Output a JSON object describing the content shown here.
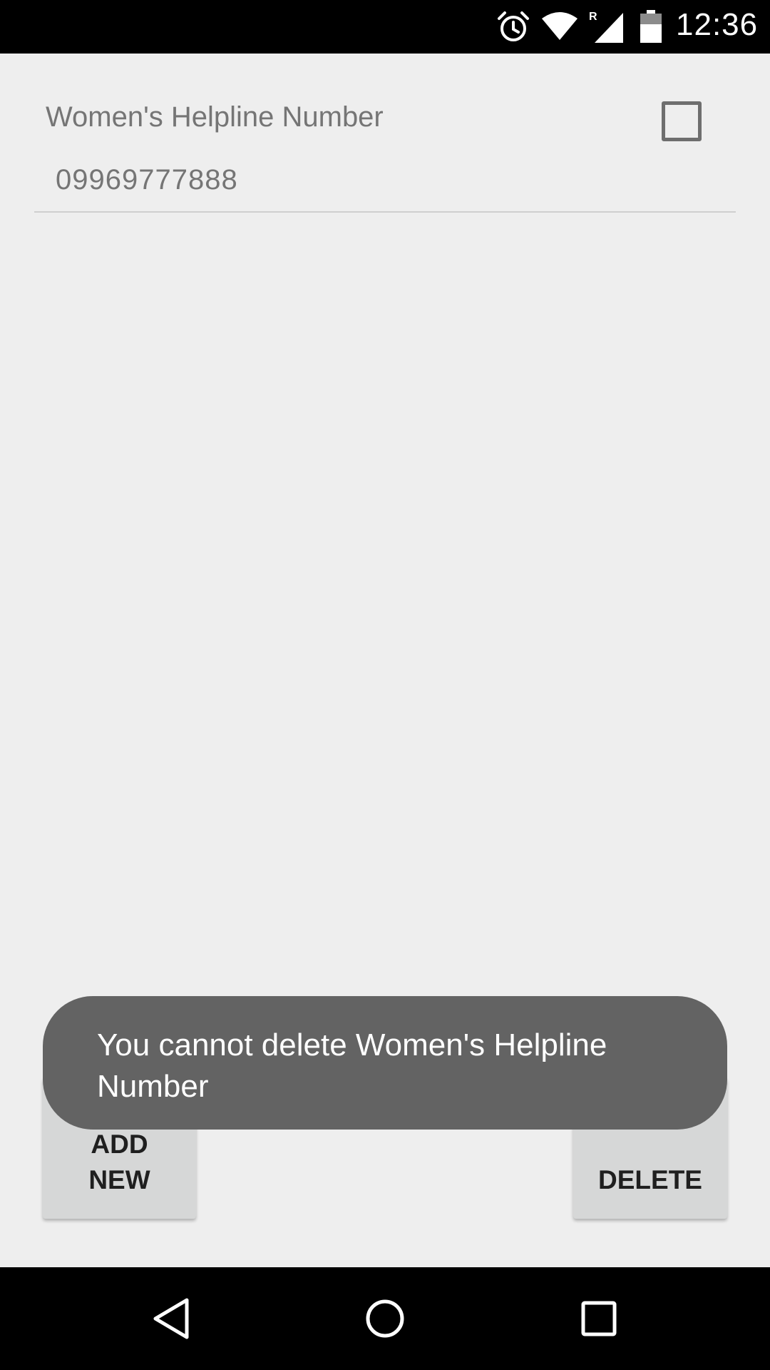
{
  "status_bar": {
    "time": "12:36",
    "icons": [
      "alarm-icon",
      "wifi-icon",
      "signal-icon",
      "battery-icon"
    ],
    "signal_roaming_label": "R"
  },
  "list": {
    "items": [
      {
        "title": "Women's Helpline Number",
        "number": "09969777888",
        "checked": false
      }
    ]
  },
  "buttons": {
    "add_new_label": "ADD NEW",
    "delete_label": "DELETE"
  },
  "toast": {
    "message": "You cannot delete Women's Helpline Number"
  },
  "nav_bar": {
    "icons": [
      "back-icon",
      "home-icon",
      "recents-icon"
    ]
  },
  "colors": {
    "background": "#eeeeee",
    "status_bar": "#000000",
    "button": "#d6d7d7",
    "toast": "#636363",
    "text_secondary": "#757575"
  }
}
